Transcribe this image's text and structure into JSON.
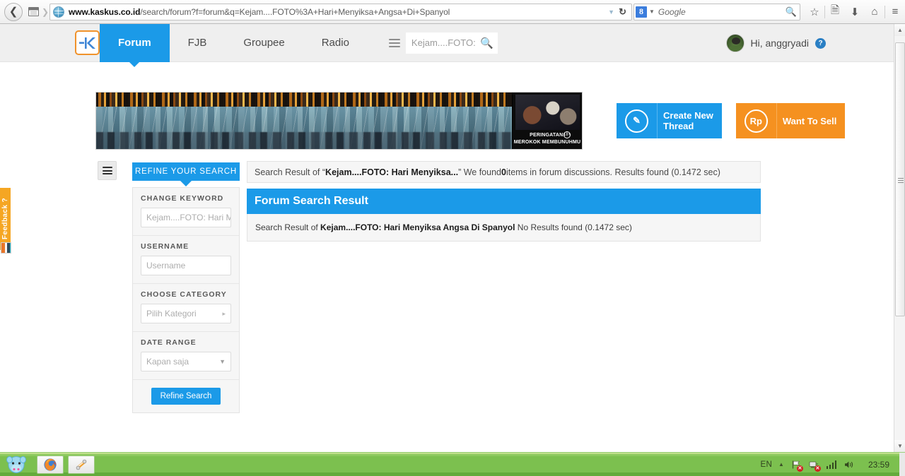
{
  "browser": {
    "back_icon": "back-arrow-icon",
    "history_icon": "history-icon",
    "url_host": "www.kaskus.co.id",
    "url_path": "/search/forum?f=forum&q=Kejam....FOTO%3A+Hari+Menyiksa+Angsa+Di+Spanyol",
    "url_full": "www.kaskus.co.id/search/forum?f=forum&q=Kejam....FOTO%3A+Hari+Menyiksa+Angsa+Di+Spanyol",
    "reload_glyph": "↻",
    "dropdown_glyph": "▼",
    "search_engine_badge": "8",
    "search_placeholder": "Google",
    "toolbar_buttons": [
      {
        "name": "bookmark-star-icon",
        "glyph": "☆"
      },
      {
        "name": "reader-list-icon",
        "glyph": "▤"
      },
      {
        "name": "downloads-icon",
        "glyph": "⬇"
      },
      {
        "name": "home-icon",
        "glyph": "⌂"
      },
      {
        "name": "menu-hamburger-icon",
        "glyph": "≡"
      }
    ]
  },
  "site_header": {
    "logo_name": "kaskus-logo",
    "nav": [
      {
        "label": "Forum",
        "active": true
      },
      {
        "label": "FJB",
        "active": false
      },
      {
        "label": "Groupee",
        "active": false
      },
      {
        "label": "Radio",
        "active": false
      }
    ],
    "search": {
      "value": "Kejam....FOTO: H",
      "icon": "search-icon"
    },
    "user": {
      "greeting": "Hi, anggryadi",
      "help_glyph": "?"
    }
  },
  "ad": {
    "warning_line1": "PERINGATAN:",
    "warning_line2": "MEROKOK MEMBUNUHMU",
    "age_badge": "18+"
  },
  "cta": {
    "create_thread": {
      "label": "Create New\nThread",
      "icon_glyph": "✎",
      "color": "#1b9ae8"
    },
    "want_to_sell": {
      "label": "Want To Sell",
      "icon_glyph": "Rp",
      "color": "#f59120"
    }
  },
  "sidebar": {
    "toggle_icon": "hamburger-icon",
    "tab_label": "REFINE YOUR SEARCH",
    "groups": [
      {
        "label": "CHANGE KEYWORD",
        "value": "Kejam....FOTO: Hari M",
        "type": "text",
        "name": "change-keyword-input"
      },
      {
        "label": "USERNAME",
        "value": "Username",
        "type": "text",
        "name": "username-input"
      },
      {
        "label": "CHOOSE CATEGORY",
        "value": "Pilih Kategori",
        "type": "flyout",
        "caret": "▸",
        "name": "choose-category-select"
      },
      {
        "label": "DATE RANGE",
        "value": "Kapan saja",
        "type": "select",
        "caret": "▼",
        "name": "date-range-select"
      }
    ],
    "submit_label": "Refine Search"
  },
  "results": {
    "summary_prefix": "Search Result of “",
    "summary_query": "Kejam....FOTO: Hari Menyiksa...",
    "summary_mid": "” We found ",
    "summary_count": "0",
    "summary_suffix": " items in forum discussions. Results found (0.1472 sec)",
    "panel_title": "Forum Search Result",
    "body_prefix": "Search Result of ",
    "body_query": "Kejam....FOTO: Hari Menyiksa Angsa Di Spanyol",
    "body_suffix": " No Results found (0.1472 sec)"
  },
  "feedback": {
    "label": "Feedback ?"
  },
  "scrollbar": {
    "up_glyph": "▲",
    "down_glyph": "▼"
  },
  "taskbar": {
    "mascot_name": "start-mascot-icon",
    "items": [
      {
        "name": "taskbar-firefox-icon"
      },
      {
        "name": "taskbar-app-icon"
      }
    ],
    "tray": {
      "language": "EN",
      "caret": "▲",
      "icons": [
        {
          "name": "flag-security-icon",
          "badge": "✕"
        },
        {
          "name": "network-disconnected-icon",
          "badge": "✕"
        },
        {
          "name": "signal-bars-icon"
        },
        {
          "name": "volume-icon"
        }
      ],
      "clock": "23:59"
    }
  }
}
